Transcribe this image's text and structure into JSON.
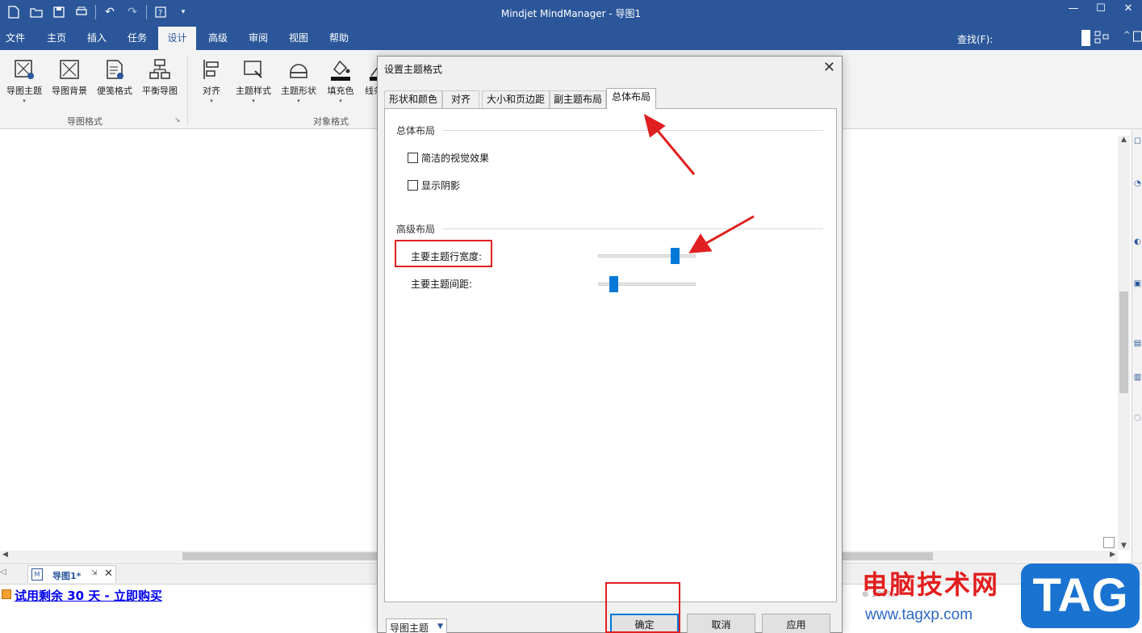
{
  "window": {
    "title": "Mindjet MindManager - 导图1",
    "controls": [
      "—",
      "☐",
      "✕"
    ]
  },
  "ribbon_tabs": [
    {
      "label": "文件"
    },
    {
      "label": "主页"
    },
    {
      "label": "插入"
    },
    {
      "label": "任务"
    },
    {
      "label": "设计",
      "active": true
    },
    {
      "label": "高级"
    },
    {
      "label": "审阅"
    },
    {
      "label": "视图"
    },
    {
      "label": "帮助"
    }
  ],
  "find": {
    "label": "查找(F):"
  },
  "ribbon": {
    "buttons": [
      {
        "label": "导图主题",
        "icon": "map-topic-icon"
      },
      {
        "label": "导图背景",
        "icon": "map-background-icon"
      },
      {
        "label": "便笺格式",
        "icon": "note-format-icon"
      },
      {
        "label": "平衡导图",
        "icon": "balance-map-icon"
      },
      {
        "label": "对齐",
        "icon": "align-icon"
      },
      {
        "label": "主题样式",
        "icon": "topic-style-icon"
      },
      {
        "label": "主题形状",
        "icon": "topic-shape-icon"
      },
      {
        "label": "填充色",
        "icon": "fill-color-icon"
      },
      {
        "label": "线条",
        "icon": "line-color-icon"
      }
    ],
    "groups": [
      {
        "label": "导图格式"
      },
      {
        "label": "对象格式"
      }
    ]
  },
  "document_tab": {
    "title": "导图1*",
    "close": "✕"
  },
  "statusbar": {
    "trial_text": "试用剩余 30 天 - 立即购买",
    "zoom": "100%"
  },
  "dialog": {
    "title": "设置主题格式",
    "close": "✕",
    "tabs": [
      {
        "label": "形状和颜色"
      },
      {
        "label": "对齐"
      },
      {
        "label": "大小和页边距"
      },
      {
        "label": "副主题布局"
      },
      {
        "label": "总体布局",
        "active": true
      }
    ],
    "sections": {
      "general": {
        "heading": "总体布局",
        "checkboxes": [
          {
            "label": "简洁的视觉效果",
            "checked": false
          },
          {
            "label": "显示阴影",
            "checked": false
          }
        ]
      },
      "advanced": {
        "heading": "高级布局",
        "sliders": [
          {
            "label": "主要主题行宽度:",
            "value": 0.82
          },
          {
            "label": "主要主题间距:",
            "value": 0.12
          }
        ]
      }
    },
    "footer": {
      "dropdown_value": "导图主题",
      "buttons": {
        "ok": "确定",
        "cancel": "取消",
        "apply": "应用"
      }
    }
  },
  "watermark": {
    "cn": "电脑技术网",
    "url": "www.tagxp.com",
    "tag": "TAG"
  },
  "colors": {
    "accent": "#2b579a",
    "slider": "#0078d7",
    "annotation": "#e02020"
  }
}
